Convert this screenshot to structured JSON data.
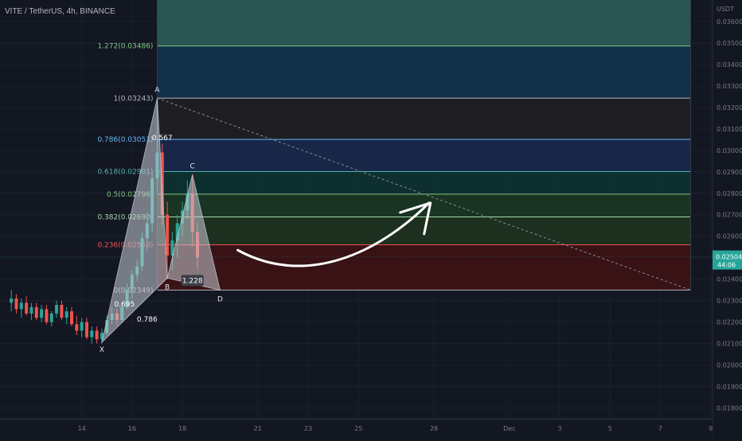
{
  "header": {
    "title": "VITE / TetherUS, 4h, BINANCE"
  },
  "chart_data": {
    "type": "candlestick",
    "y_unit": "USDT",
    "ylim": [
      0.0175,
      0.037
    ],
    "y_ticks": [
      "0.03600",
      "0.03500",
      "0.03400",
      "0.03300",
      "0.03200",
      "0.03100",
      "0.03000",
      "0.02900",
      "0.02800",
      "0.02700",
      "0.02600",
      "0.02500",
      "0.02400",
      "0.02300",
      "0.02200",
      "0.02100",
      "0.02000",
      "0.01900",
      "0.01800"
    ],
    "y_tick_values": [
      0.036,
      0.035,
      0.034,
      0.033,
      0.032,
      0.031,
      0.03,
      0.029,
      0.028,
      0.027,
      0.026,
      0.025,
      0.024,
      0.023,
      0.022,
      0.021,
      0.02,
      0.019,
      0.018
    ],
    "x_ticks": [
      {
        "label": "14",
        "day": 14
      },
      {
        "label": "16",
        "day": 16
      },
      {
        "label": "18",
        "day": 18
      },
      {
        "label": "21",
        "day": 21
      },
      {
        "label": "23",
        "day": 23
      },
      {
        "label": "25",
        "day": 25
      },
      {
        "label": "28",
        "day": 28
      },
      {
        "label": "Dec",
        "day": 31
      },
      {
        "label": "3",
        "day": 33
      },
      {
        "label": "5",
        "day": 35
      },
      {
        "label": "7",
        "day": 37
      },
      {
        "label": "9",
        "day": 39
      }
    ],
    "current_price": {
      "value": 0.02504,
      "label": "0.02504",
      "countdown": "44:06"
    },
    "fib_levels": [
      {
        "label": "1.272(0.03486)",
        "value": 0.03486,
        "color": "#81c784"
      },
      {
        "label": "1(0.03243)",
        "value": 0.03243,
        "color": "#b2b5be"
      },
      {
        "label": "0.786(0.03051)",
        "value": 0.03051,
        "color": "#64b5f6"
      },
      {
        "label": "0.618(0.02901)",
        "value": 0.02901,
        "color": "#4db6ac"
      },
      {
        "label": "0.5(0.02796)",
        "value": 0.02796,
        "color": "#81c784"
      },
      {
        "label": "0.382(0.02690)",
        "value": 0.0269,
        "color": "#a5d6a7"
      },
      {
        "label": "0.236(0.02560)",
        "value": 0.0256,
        "color": "#ef5350"
      },
      {
        "label": "0(0.02349)",
        "value": 0.02349,
        "color": "#b2b5be"
      }
    ],
    "fib_zone_colors": [
      "#2a5a54",
      "#12304c",
      "#1f1f23",
      "#18284a",
      "#0d3230",
      "#1a3624",
      "#1e3220",
      "#3a1214"
    ],
    "fib_range_days": [
      17.0,
      38.2
    ],
    "pattern_points": [
      {
        "label": "X",
        "day": 14.8,
        "value": 0.02106
      },
      {
        "label": "A",
        "day": 17.0,
        "value": 0.03243
      },
      {
        "label": "B",
        "day": 17.4,
        "value": 0.02405
      },
      {
        "label": "C",
        "day": 18.4,
        "value": 0.02886
      },
      {
        "label": "D",
        "day": 19.5,
        "value": 0.02349
      }
    ],
    "pattern_ratios": [
      {
        "label": "0.567",
        "day": 17.2,
        "value": 0.0307
      },
      {
        "label": "0.695",
        "day": 15.7,
        "value": 0.02295
      },
      {
        "label": "0.786",
        "day": 16.6,
        "value": 0.02225
      },
      {
        "label": "1.228",
        "day": 18.4,
        "value": 0.02405
      }
    ],
    "trendline": [
      {
        "day": 17.0,
        "value": 0.03243
      },
      {
        "day": 38.2,
        "value": 0.02349
      }
    ],
    "arrow_points": [
      {
        "day": 20.2,
        "value": 0.02535
      },
      {
        "day": 23.2,
        "value": 0.02455
      },
      {
        "day": 26.2,
        "value": 0.02565
      },
      {
        "day": 27.8,
        "value": 0.02755
      }
    ],
    "candles": [
      [
        11.2,
        0.0229,
        0.0235,
        0.0225,
        0.0231
      ],
      [
        11.4,
        0.0231,
        0.0233,
        0.0224,
        0.0226
      ],
      [
        11.6,
        0.0226,
        0.0231,
        0.0222,
        0.0229
      ],
      [
        11.8,
        0.0229,
        0.0232,
        0.0223,
        0.0224
      ],
      [
        12.0,
        0.0224,
        0.0229,
        0.0221,
        0.0227
      ],
      [
        12.2,
        0.0227,
        0.0229,
        0.0221,
        0.0222
      ],
      [
        12.4,
        0.0222,
        0.0228,
        0.022,
        0.0226
      ],
      [
        12.6,
        0.0226,
        0.0228,
        0.0219,
        0.022
      ],
      [
        12.8,
        0.022,
        0.0225,
        0.0218,
        0.0224
      ],
      [
        13.0,
        0.0224,
        0.023,
        0.0222,
        0.0228
      ],
      [
        13.2,
        0.0228,
        0.023,
        0.0221,
        0.0222
      ],
      [
        13.4,
        0.0222,
        0.0227,
        0.0219,
        0.0225
      ],
      [
        13.6,
        0.0225,
        0.0227,
        0.0218,
        0.0219
      ],
      [
        13.8,
        0.0219,
        0.0223,
        0.0214,
        0.0216
      ],
      [
        14.0,
        0.0216,
        0.0222,
        0.0213,
        0.022
      ],
      [
        14.2,
        0.022,
        0.0222,
        0.0212,
        0.0213
      ],
      [
        14.4,
        0.0213,
        0.0218,
        0.021,
        0.0216
      ],
      [
        14.6,
        0.0216,
        0.0218,
        0.021,
        0.0212
      ],
      [
        14.8,
        0.0212,
        0.0217,
        0.021,
        0.0215
      ],
      [
        15.0,
        0.0215,
        0.0223,
        0.0214,
        0.0221
      ],
      [
        15.2,
        0.0221,
        0.0227,
        0.0219,
        0.0224
      ],
      [
        15.4,
        0.0224,
        0.0226,
        0.0219,
        0.0221
      ],
      [
        15.6,
        0.0221,
        0.0229,
        0.022,
        0.0227
      ],
      [
        15.8,
        0.0227,
        0.0238,
        0.0226,
        0.0235
      ],
      [
        16.0,
        0.0235,
        0.0244,
        0.0231,
        0.0242
      ],
      [
        16.2,
        0.0242,
        0.0249,
        0.0239,
        0.0246
      ],
      [
        16.4,
        0.0246,
        0.0262,
        0.0244,
        0.0259
      ],
      [
        16.6,
        0.0259,
        0.0271,
        0.0253,
        0.0266
      ],
      [
        16.8,
        0.0266,
        0.029,
        0.0262,
        0.0287
      ],
      [
        17.0,
        0.0287,
        0.0324,
        0.028,
        0.0299
      ],
      [
        17.2,
        0.0299,
        0.0303,
        0.0265,
        0.027
      ],
      [
        17.4,
        0.027,
        0.0276,
        0.024,
        0.0251
      ],
      [
        17.6,
        0.0251,
        0.0262,
        0.0244,
        0.0258
      ],
      [
        17.8,
        0.0258,
        0.027,
        0.025,
        0.0266
      ],
      [
        18.0,
        0.0266,
        0.0276,
        0.026,
        0.0272
      ],
      [
        18.2,
        0.0272,
        0.0286,
        0.0268,
        0.028
      ],
      [
        18.4,
        0.028,
        0.0289,
        0.0255,
        0.0262
      ],
      [
        18.6,
        0.0262,
        0.0266,
        0.0245,
        0.025
      ]
    ]
  }
}
